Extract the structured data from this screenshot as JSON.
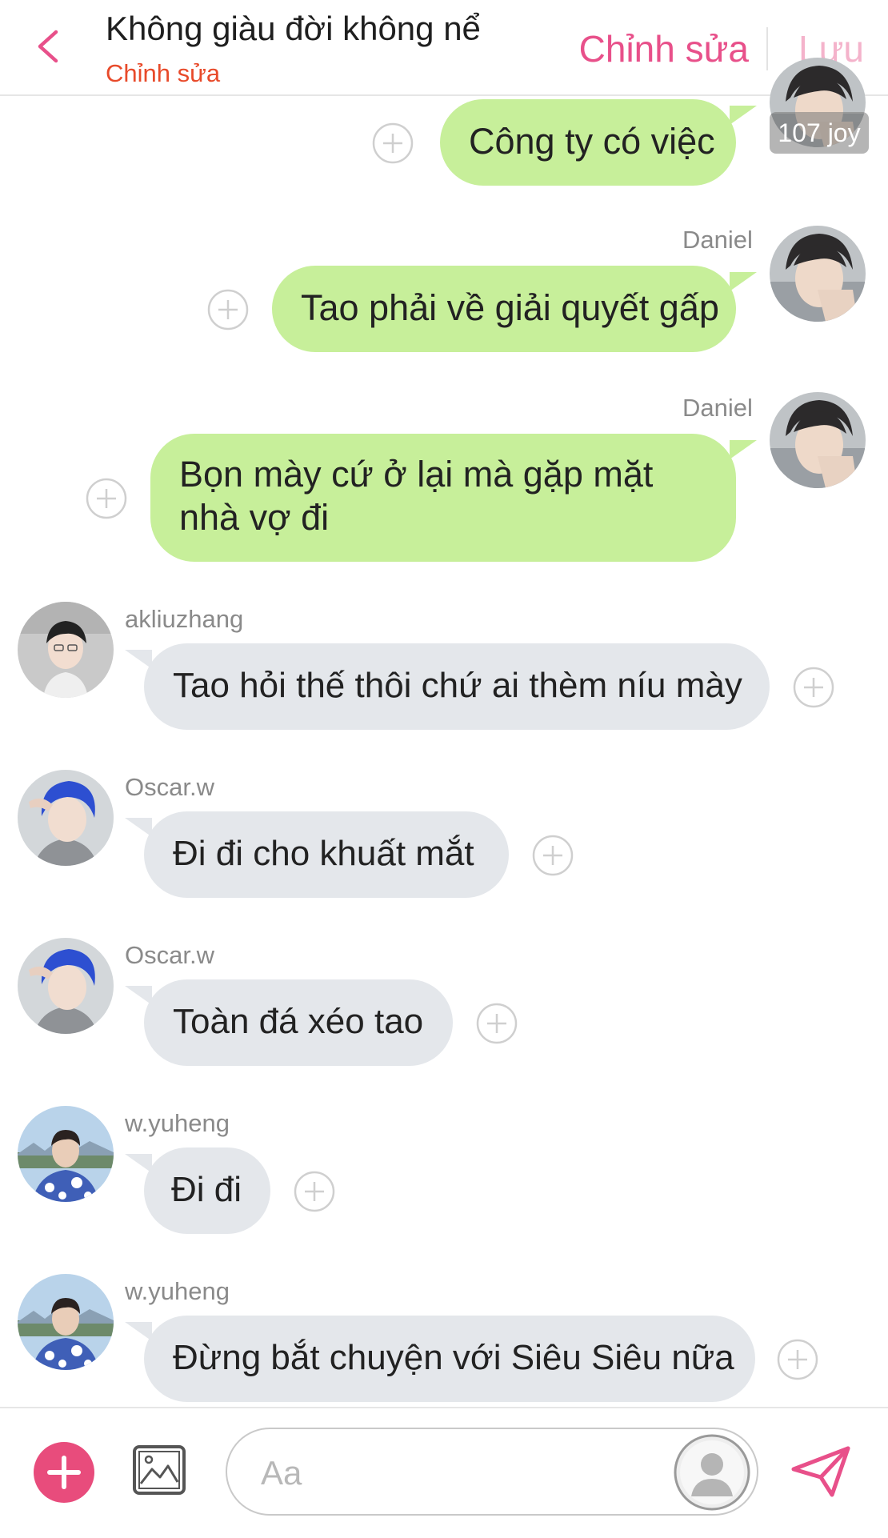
{
  "header": {
    "title": "Không giàu đời không nể",
    "subtitle": "Chỉnh sửa",
    "edit_label": "Chỉnh sửa",
    "save_label": "Lưu"
  },
  "badge": "107 joy",
  "messages": [
    {
      "sender": "",
      "text": "Công ty có việc",
      "direction": "out"
    },
    {
      "sender": "Daniel",
      "text": "Tao phải về giải quyết gấp",
      "direction": "out"
    },
    {
      "sender": "Daniel",
      "text": "Bọn mày cứ ở lại mà gặp mặt nhà vợ đi",
      "direction": "out"
    },
    {
      "sender": "akliuzhang",
      "text": "Tao hỏi thế thôi chứ ai thèm níu mày",
      "direction": "in"
    },
    {
      "sender": "Oscar.w",
      "text": "Đi đi cho khuất mắt",
      "direction": "in"
    },
    {
      "sender": "Oscar.w",
      "text": "Toàn đá xéo tao",
      "direction": "in"
    },
    {
      "sender": "w.yuheng",
      "text": "Đi đi",
      "direction": "in"
    },
    {
      "sender": "w.yuheng",
      "text": "Đừng bắt chuyện với Siêu Siêu nữa",
      "direction": "in"
    }
  ],
  "composer": {
    "placeholder": "Aa"
  },
  "colors": {
    "accent": "#e8508a",
    "outgoing_bubble": "#c7ef9a",
    "incoming_bubble": "#e4e7eb",
    "subtitle": "#e84a2a"
  },
  "icons": [
    "chevron-left-icon",
    "plus-circle-icon",
    "image-icon",
    "user-silhouette-icon",
    "send-icon",
    "add-icon"
  ]
}
